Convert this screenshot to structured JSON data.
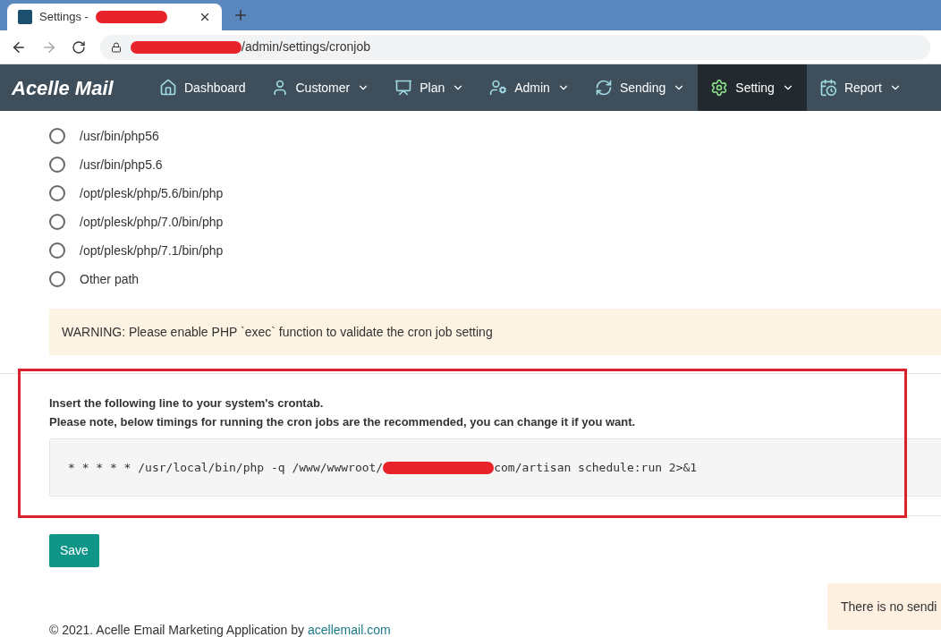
{
  "browser": {
    "tab_title": "Settings -",
    "url": "/admin/settings/cronjob"
  },
  "navbar": {
    "logo": "Acelle",
    "logo_second": "Mail",
    "items": [
      {
        "label": "Dashboard",
        "has_caret": false,
        "selected": false
      },
      {
        "label": "Customer",
        "has_caret": true,
        "selected": false
      },
      {
        "label": "Plan",
        "has_caret": true,
        "selected": false
      },
      {
        "label": "Admin",
        "has_caret": true,
        "selected": false
      },
      {
        "label": "Sending",
        "has_caret": true,
        "selected": false
      },
      {
        "label": "Setting",
        "has_caret": true,
        "selected": true
      },
      {
        "label": "Report",
        "has_caret": true,
        "selected": false
      }
    ]
  },
  "php_paths": [
    {
      "label": "/usr/bin/php56",
      "selected": false
    },
    {
      "label": "/usr/bin/php5.6",
      "selected": false
    },
    {
      "label": "/opt/plesk/php/5.6/bin/php",
      "selected": false
    },
    {
      "label": "/opt/plesk/php/7.0/bin/php",
      "selected": false
    },
    {
      "label": "/opt/plesk/php/7.1/bin/php",
      "selected": false
    },
    {
      "label": "Other path",
      "selected": false
    }
  ],
  "warning": "WARNING: Please enable PHP `exec` function to validate the cron job setting",
  "crontab": {
    "intro": "Insert the following line to your system's crontab.",
    "note": "Please note, below timings for running the cron jobs are the recommended, you can change it if you want.",
    "command_start": "* * * * * /usr/local/bin/php -q /www/wwwroot/",
    "command_end": "com/artisan schedule:run 2>&1"
  },
  "save_button": "Save",
  "footer": {
    "text": "© 2021. Acelle Email Marketing Application by",
    "link": "acellemail.com"
  },
  "toast": "There is no sendi"
}
